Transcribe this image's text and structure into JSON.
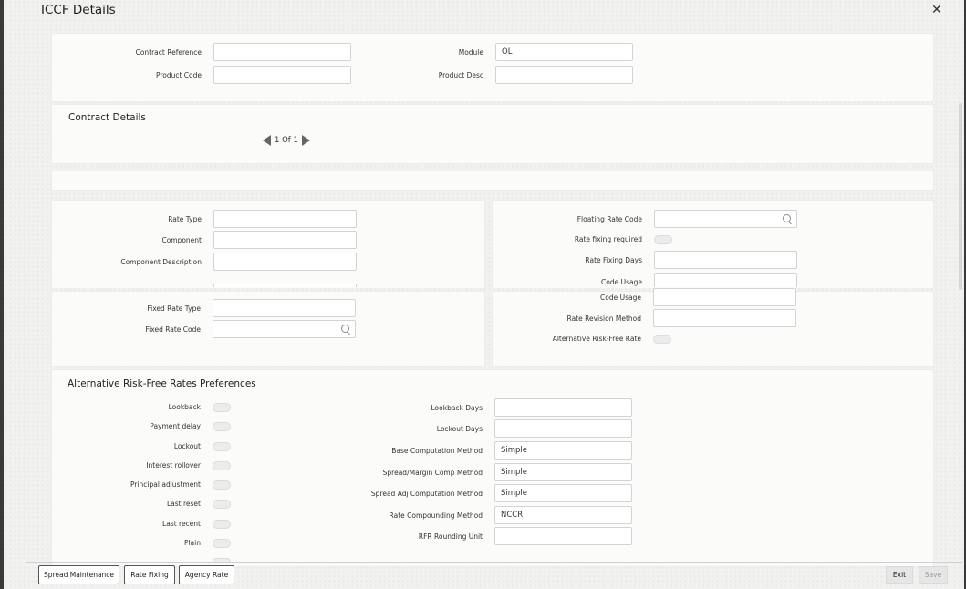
{
  "window": {
    "title": "ICCF Details",
    "close_glyph": "✕"
  },
  "header": {
    "contract_reference": {
      "label": "Contract Reference",
      "value": ""
    },
    "module": {
      "label": "Module",
      "value": "OL"
    },
    "product_code": {
      "label": "Product Code",
      "value": ""
    },
    "product_desc": {
      "label": "Product Desc",
      "value": ""
    }
  },
  "contract_details": {
    "title": "Contract Details",
    "pager": "1 Of 1"
  },
  "left_panel": {
    "rate_type": {
      "label": "Rate Type",
      "value": ""
    },
    "component": {
      "label": "Component",
      "value": ""
    },
    "component_description": {
      "label": "Component Description",
      "value": ""
    },
    "fixed_rate_type": {
      "label": "Fixed Rate Type",
      "value": ""
    },
    "fixed_rate_code": {
      "label": "Fixed Rate Code",
      "value": ""
    }
  },
  "right_panel": {
    "floating_rate_code": {
      "label": "Floating Rate Code",
      "value": ""
    },
    "rate_fixing_required": {
      "label": "Rate fixing required"
    },
    "rate_fixing_days": {
      "label": "Rate Fixing Days",
      "value": ""
    },
    "code_usage_upper": {
      "label": "Code Usage"
    },
    "code_usage": {
      "label": "Code Usage",
      "value": ""
    },
    "rate_revision_method": {
      "label": "Rate Revision Method",
      "value": ""
    },
    "alternative_rfr": {
      "label": "Alternative Risk-Free Rate"
    }
  },
  "arfr": {
    "title": "Alternative Risk-Free Rates Preferences",
    "toggles": [
      "Lookback",
      "Payment delay",
      "Lockout",
      "Interest rollover",
      "Principal adjustment",
      "Last reset",
      "Last recent",
      "Plain"
    ],
    "fields": [
      {
        "label": "Lookback Days",
        "value": ""
      },
      {
        "label": "Lockout Days",
        "value": ""
      },
      {
        "label": "Base Computation Method",
        "value": "Simple"
      },
      {
        "label": "Spread/Margin Comp Method",
        "value": "Simple"
      },
      {
        "label": "Spread Adj Computation Method",
        "value": "Simple"
      },
      {
        "label": "Rate Compounding Method",
        "value": "NCCR"
      },
      {
        "label": "RFR Rounding Unit",
        "value": ""
      }
    ]
  },
  "footer": {
    "buttons": [
      "Spread Maintenance",
      "Rate Fixing",
      "Agency Rate"
    ],
    "exit": "Exit",
    "save": "Save"
  }
}
